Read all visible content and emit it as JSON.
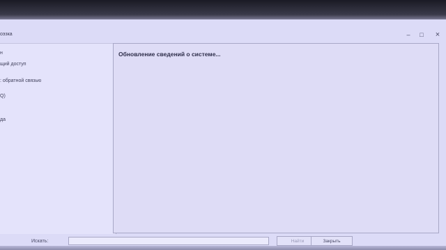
{
  "window": {
    "title": "оэзка",
    "minimize_icon": "minimize-icon",
    "maximize_icon": "maximize-icon",
    "close_icon": "close-icon"
  },
  "sidebar": {
    "items": [
      {
        "label": "н"
      },
      {
        "label": "щий доступ"
      },
      {
        "label": ": обратной связью"
      },
      {
        "label": "Q)"
      },
      {
        "label": "да"
      }
    ]
  },
  "content": {
    "status_text": "Обновление сведений о системе..."
  },
  "footer": {
    "search_label": "Искать:",
    "search_value": "",
    "find_button": "Найти",
    "close_button": "Закрыть"
  },
  "colors": {
    "background": "#dcdbf7",
    "border": "#a8a7c6",
    "text": "#2e2e4a"
  }
}
